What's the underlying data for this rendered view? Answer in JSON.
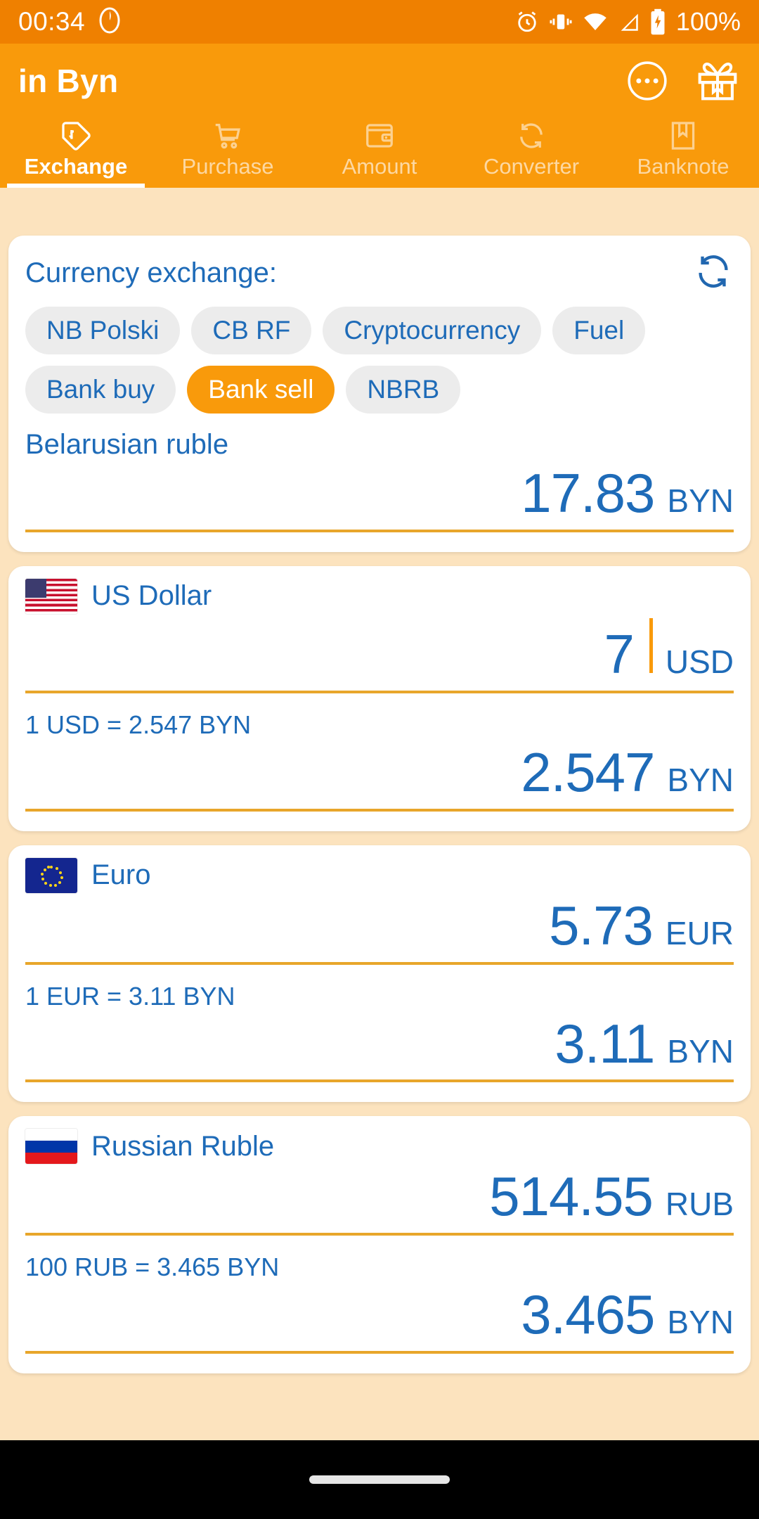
{
  "status_bar": {
    "time": "00:34",
    "battery_text": "100%",
    "icons": [
      "app-notification-icon",
      "alarm-icon",
      "vibrate-icon",
      "wifi-icon",
      "signal-icon",
      "battery-icon"
    ]
  },
  "app_bar": {
    "title": "in Byn",
    "actions": [
      "overflow-menu-icon",
      "gift-icon"
    ]
  },
  "tabs": [
    {
      "label": "Exchange",
      "icon": "price-tag-icon",
      "active": true
    },
    {
      "label": "Purchase",
      "icon": "shopping-cart-icon",
      "active": false
    },
    {
      "label": "Amount",
      "icon": "wallet-icon",
      "active": false
    },
    {
      "label": "Converter",
      "icon": "convert-arrows-icon",
      "active": false
    },
    {
      "label": "Banknote",
      "icon": "banknote-bookmark-icon",
      "active": false
    }
  ],
  "exchange_card": {
    "title": "Currency exchange:",
    "refresh_icon": "refresh-swap-icon",
    "sources": [
      {
        "label": "NB Polski",
        "selected": false
      },
      {
        "label": "CB RF",
        "selected": false
      },
      {
        "label": "Cryptocurrency",
        "selected": false
      },
      {
        "label": "Fuel",
        "selected": false
      },
      {
        "label": "Bank buy",
        "selected": false
      },
      {
        "label": "Bank sell",
        "selected": true
      },
      {
        "label": "NBRB",
        "selected": false
      }
    ],
    "base_currency_name": "Belarusian ruble",
    "base_amount": "17.83",
    "base_code": "BYN"
  },
  "currencies": [
    {
      "flag": "us-flag",
      "name": "US Dollar",
      "amount": "7",
      "code": "USD",
      "focused": true,
      "rate_line": "1 USD = 2.547 BYN",
      "converted_amount": "2.547",
      "converted_code": "BYN"
    },
    {
      "flag": "eu-flag",
      "name": "Euro",
      "amount": "5.73",
      "code": "EUR",
      "focused": false,
      "rate_line": "1 EUR = 3.11 BYN",
      "converted_amount": "3.11",
      "converted_code": "BYN"
    },
    {
      "flag": "ru-flag",
      "name": "Russian Ruble",
      "amount": "514.55",
      "code": "RUB",
      "focused": false,
      "rate_line": "100 RUB = 3.465 BYN",
      "converted_amount": "3.465",
      "converted_code": "BYN"
    }
  ],
  "colors": {
    "status_bar": "#EF8000",
    "app_bar": "#F99A0B",
    "accent_orange": "#F99A0B",
    "page_background": "#FCE3BE",
    "text_blue": "#1E6BB8",
    "chip_background": "#ECECEC",
    "underline": "#E8A62B"
  },
  "nav_bar": {
    "handle": "home-indicator"
  }
}
